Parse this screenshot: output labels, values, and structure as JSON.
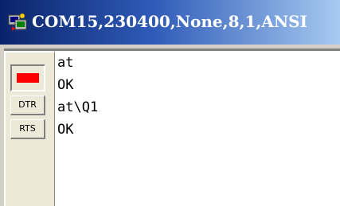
{
  "window": {
    "title": "COM15,230400,None,8,1,ANSI",
    "icon": "terminal-app-icon"
  },
  "sidebar": {
    "indicator": {
      "icon": "status-led",
      "color": "#ff0000"
    },
    "buttons": {
      "dtr_label": "DTR",
      "rts_label": "RTS"
    }
  },
  "terminal": {
    "lines": [
      "at",
      "OK",
      "at\\Q1",
      "OK"
    ]
  },
  "colors": {
    "titlebar_start": "#0a246a",
    "titlebar_end": "#a6caf0",
    "led": "#ff0000"
  }
}
